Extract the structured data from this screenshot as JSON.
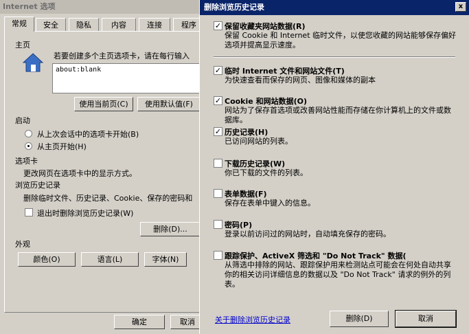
{
  "back_window": {
    "title": "Internet 选项",
    "tabs": [
      "常规",
      "安全",
      "隐私",
      "内容",
      "连接",
      "程序"
    ],
    "homepage": {
      "heading": "主页",
      "instruction": "若要创建多个主页选项卡，请在每行输入",
      "value": "about:blank",
      "use_current": "使用当前页(C)",
      "use_default": "使用默认值(F)"
    },
    "startup": {
      "heading": "启动",
      "options": [
        "从上次会话中的选项卡开始(B)",
        "从主页开始(H)"
      ],
      "selected_index": 1
    },
    "tabs_section": {
      "heading": "选项卡",
      "desc": "更改网页在选项卡中的显示方式。"
    },
    "history": {
      "heading": "浏览历史记录",
      "desc": "删除临时文件、历史记录、Cookie、保存的密码和",
      "delete_on_exit": "退出时删除浏览历史记录(W)",
      "delete_btn": "删除(D)..."
    },
    "appearance": {
      "heading": "外观",
      "colors": "颜色(O)",
      "languages": "语言(L)",
      "fonts": "字体(N)"
    },
    "ok": "确定",
    "cancel": "取消"
  },
  "dialog": {
    "title": "删除浏览历史记录",
    "close": "x",
    "options": [
      {
        "title": "保留收藏夹网站数据(R)",
        "desc": "保留 Cookie 和 Internet 临时文件，以使您收藏的网站能够保存偏好选项并提高显示速度。",
        "checked": true
      },
      {
        "title": "临时 Internet 文件和网站文件(T)",
        "desc": "为快速查看而保存的网页、图像和媒体的副本",
        "checked": true
      },
      {
        "title": "Cookie 和网站数据(O)",
        "desc": "网站为了保存首选项或改善网站性能而存储在你计算机上的文件或数据库。",
        "checked": true
      },
      {
        "title": "历史记录(H)",
        "desc": "已访问网站的列表。",
        "checked": true
      },
      {
        "title": "下载历史记录(W)",
        "desc": "你已下载的文件的列表。",
        "checked": false
      },
      {
        "title": "表单数据(F)",
        "desc": "保存在表单中键入的信息。",
        "checked": false
      },
      {
        "title": "密码(P)",
        "desc": "登录以前访问过的网站时，自动填充保存的密码。",
        "checked": false
      },
      {
        "title": "跟踪保护、ActiveX 筛选和 \"Do Not Track\" 数据(",
        "desc": "从筛选中排除的网站、跟踪保护用来检测站点可能会在何处自动共享你的相关访问详细信息的数据以及 \"Do Not Track\" 请求的例外的列表。",
        "checked": false
      }
    ],
    "check_mark": "✓",
    "link": "关于删除浏览历史记录",
    "delete_btn": "删除(D)",
    "cancel_btn": "取消"
  }
}
